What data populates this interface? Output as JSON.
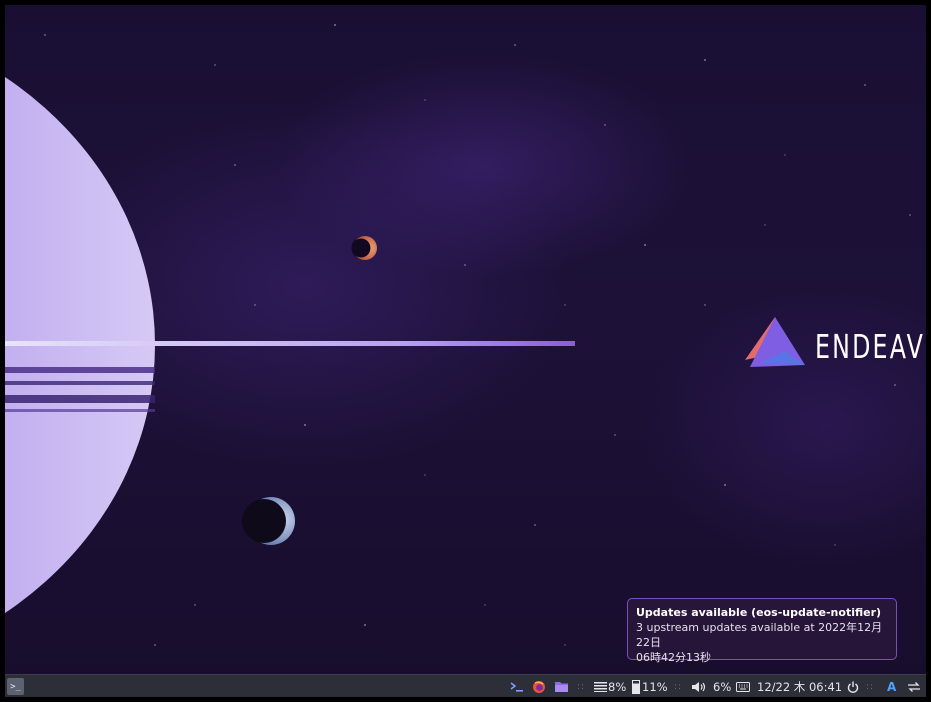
{
  "wallpaper": {
    "brand_name": "ENDEAVOU",
    "colors": {
      "space": "#1a0f33",
      "planet": "#a78be6",
      "logo_red": "#e06a6a",
      "logo_purple": "#7a5be0",
      "logo_blue": "#5a6fe0"
    }
  },
  "notification": {
    "title": "Updates available (eos-update-notifier)",
    "line1": "3 upstream updates available at 2022年12月22日",
    "line2": "06時42分13秒"
  },
  "taskbar": {
    "start_icon": "terminal-start-icon",
    "cpu": "8%",
    "memory": "11%",
    "volume": "6%",
    "clock": "12/22 木 06:41",
    "keyboard_layout": "A"
  }
}
